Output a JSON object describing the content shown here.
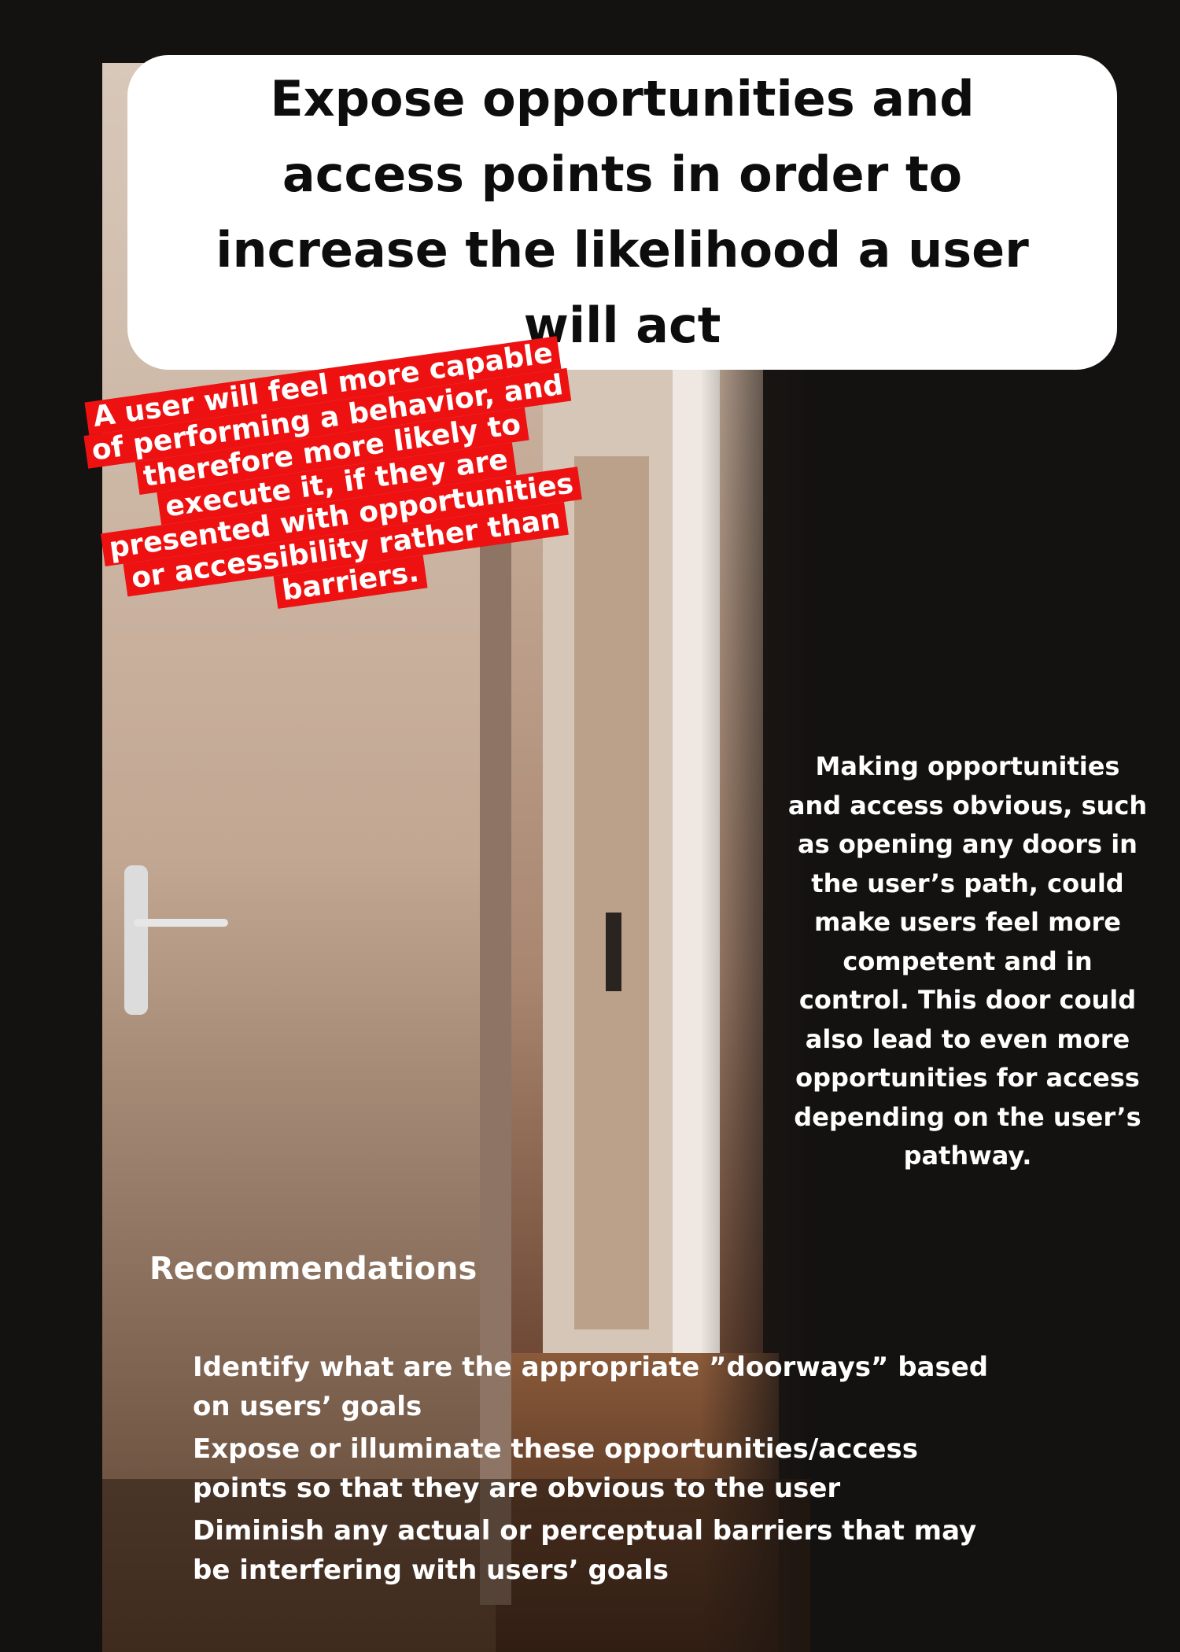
{
  "title": "Expose opportunities and access points in order to increase the likelihood a user will act",
  "callout_lines": [
    "A user will feel more capable",
    "of performing a behavior, and",
    "therefore more likely to",
    "execute it, if they are",
    "presented with opportunities",
    "or accessibility rather than",
    "barriers."
  ],
  "side_text": "Making opportunities and access obvious, such as opening any doors in the user’s path, could make users feel more competent and in control. This door could also lead to even more opportunities for access depending on the user’s pathway.",
  "recommendations": {
    "heading": "Recommendations",
    "items": [
      "Identify what are the appropriate ”doorways” based on users’ goals",
      "Expose or illuminate these opportunities/access points so that they are obvious to the user",
      "Diminish any actual or perceptual barriers that may be interfering with users’ goals"
    ]
  },
  "colors": {
    "background": "#141211",
    "title_box": "#ffffff",
    "callout": "#ee1111",
    "text_light": "#ffffff"
  }
}
